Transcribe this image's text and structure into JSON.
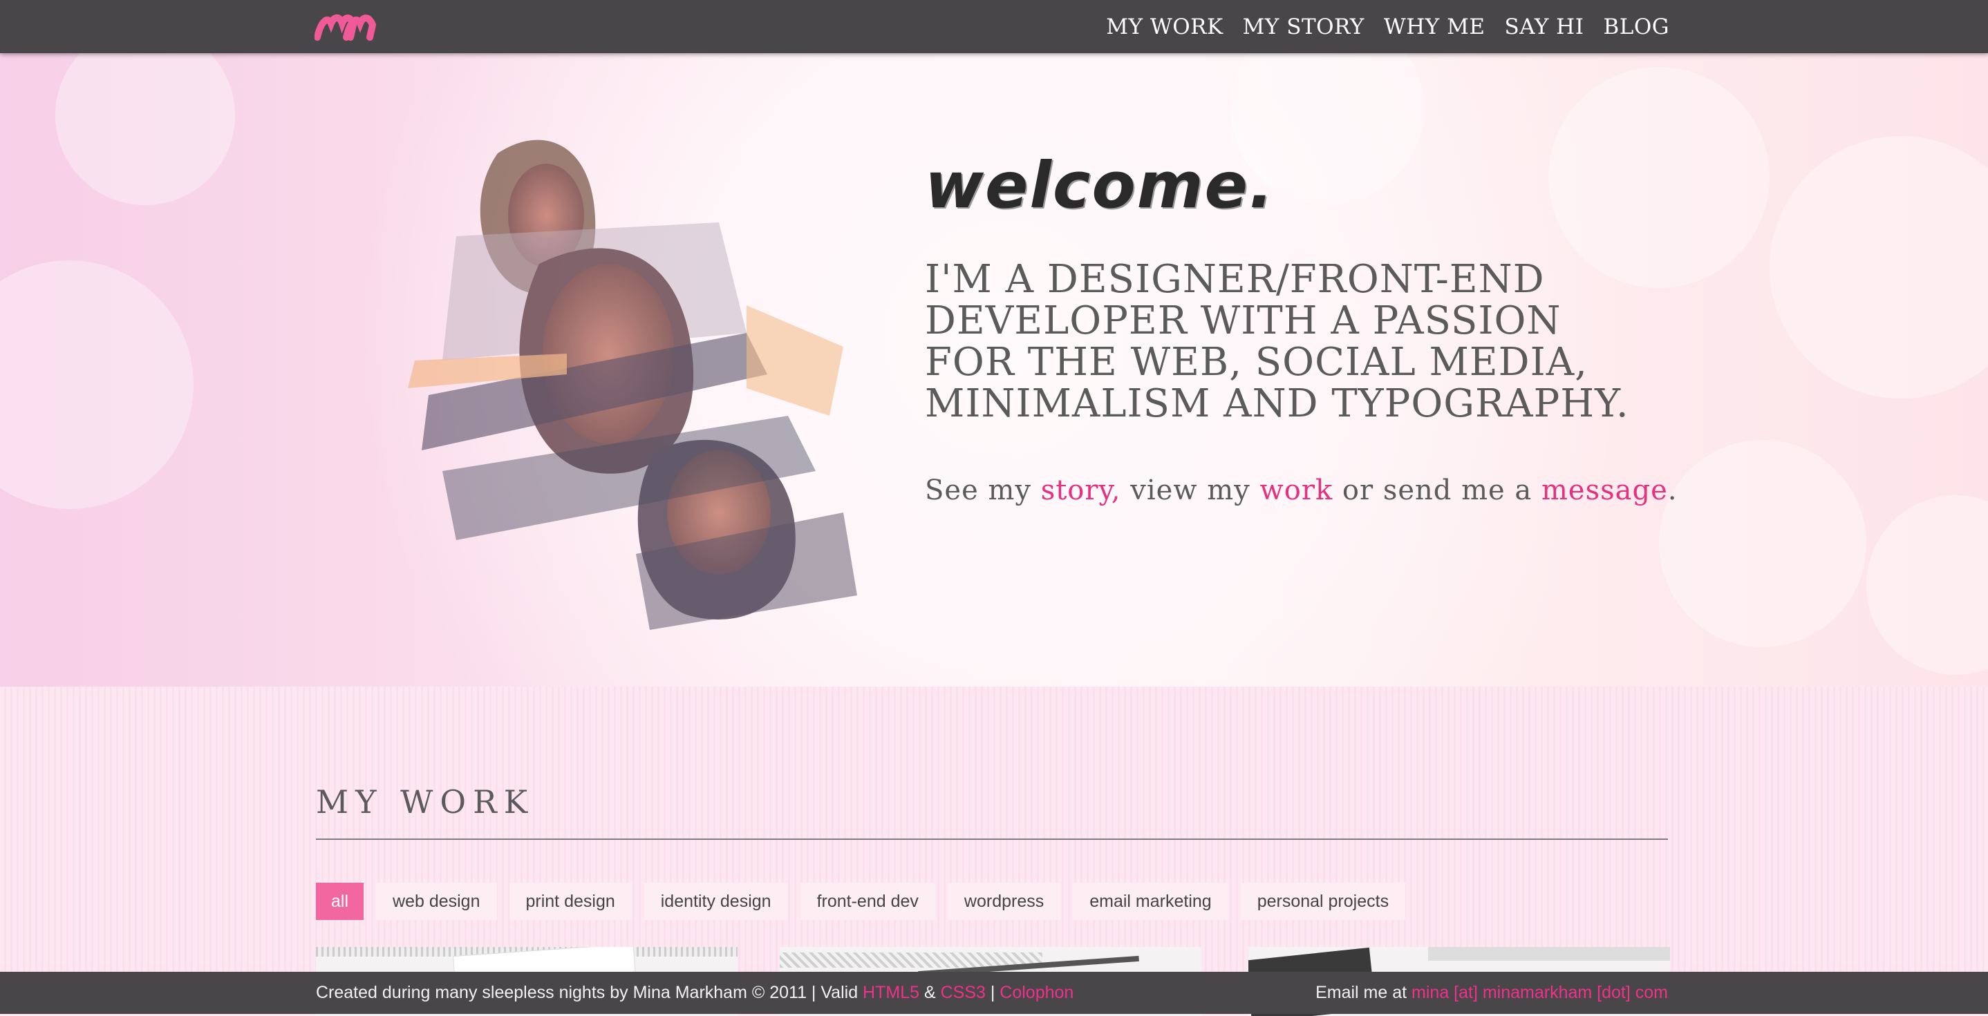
{
  "header": {
    "nav": [
      "MY WORK",
      "MY STORY",
      "WHY ME",
      "SAY HI",
      "BLOG"
    ]
  },
  "hero": {
    "welcome": "welcome.",
    "intro": "I'M A DESIGNER/FRONT-END DEVELOPER WITH A PASSION FOR THE WEB, SOCIAL MEDIA, MINIMALISM AND TYPOGRAPHY.",
    "cta": {
      "part1": "See my ",
      "story": "story,",
      "part2": " view my ",
      "work": "work",
      "part3": " or send me a ",
      "message": "message",
      "part4": "."
    }
  },
  "work": {
    "title": "MY WORK",
    "filters": [
      "all",
      "web design",
      "print design",
      "identity design",
      "front-end dev",
      "wordpress",
      "email marketing",
      "personal projects"
    ],
    "active_filter": "all"
  },
  "footer": {
    "left_text": "Created during many sleepless nights by Mina Markham © 2011 | Valid ",
    "html5": "HTML5",
    "amp": " & ",
    "css3": "CSS3",
    "sep": " | ",
    "colophon": "Colophon",
    "email_label": "Email me at ",
    "email": "mina [at] minamarkham [dot] com"
  },
  "colors": {
    "accent": "#e6317f",
    "bar": "#484648",
    "filter_active": "#f2679f"
  }
}
